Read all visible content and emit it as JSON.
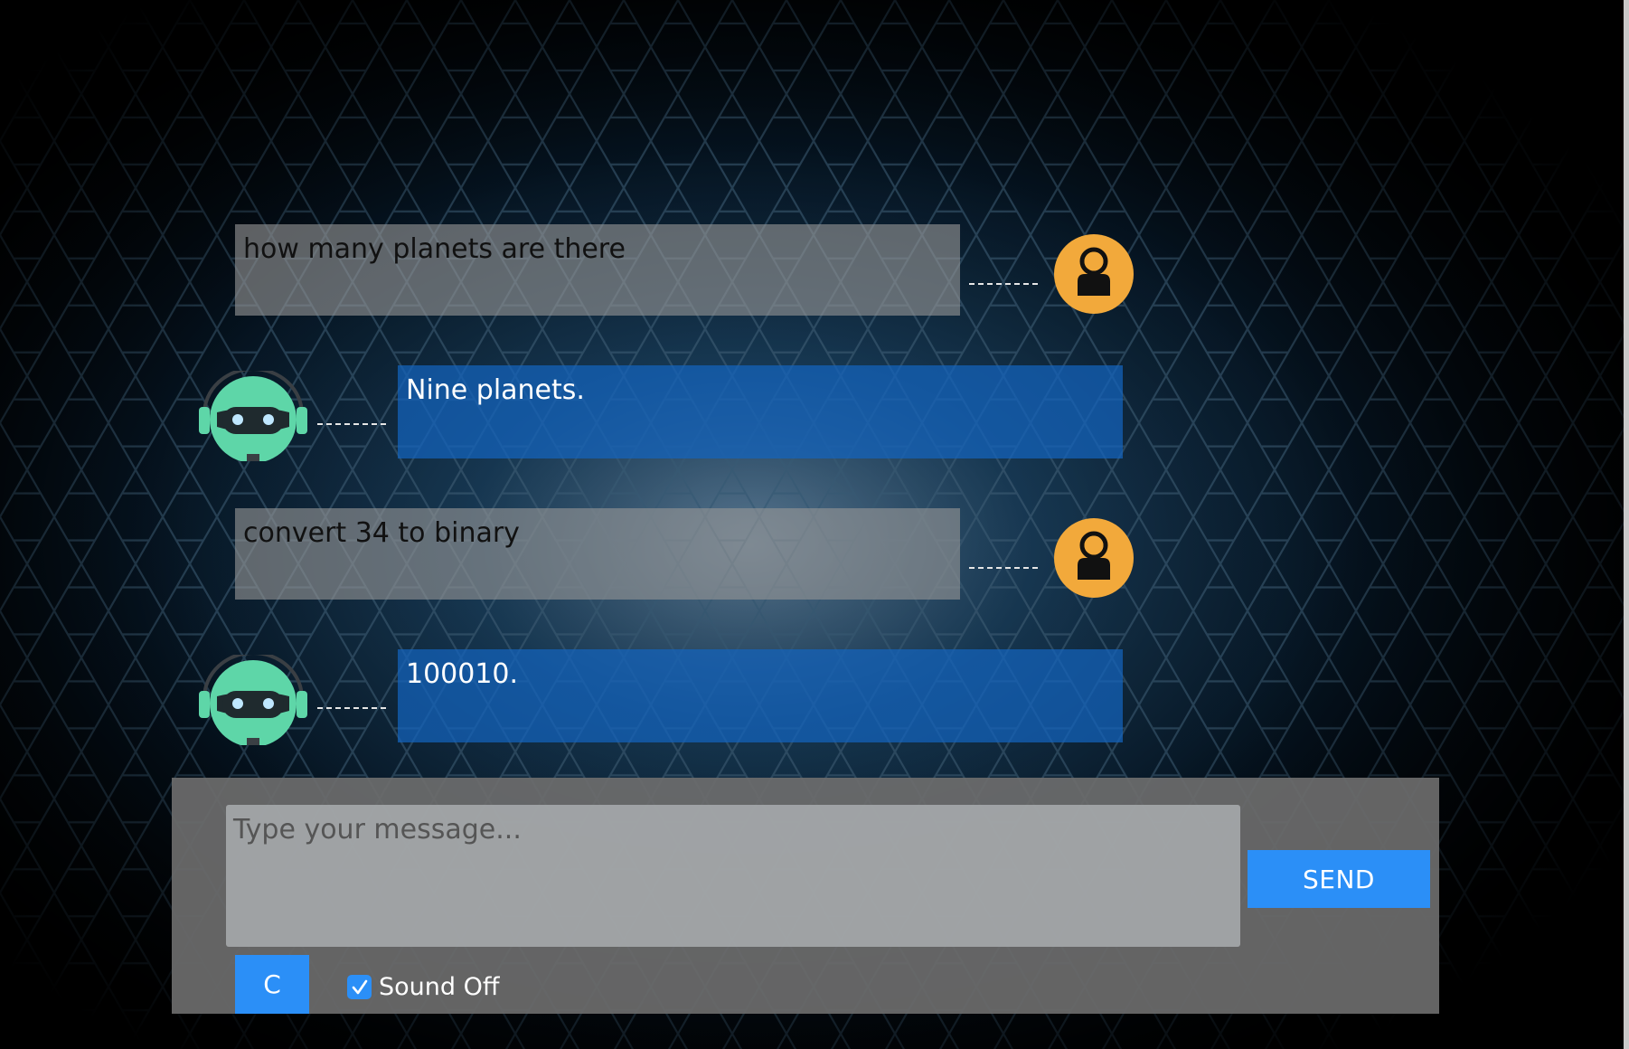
{
  "messages": [
    {
      "sender": "user",
      "text": "how many planets are there"
    },
    {
      "sender": "bot",
      "text": "Nine planets."
    },
    {
      "sender": "user",
      "text": "convert 34 to binary"
    },
    {
      "sender": "bot",
      "text": "100010."
    }
  ],
  "composer": {
    "placeholder": "Type your message...",
    "send_label": "SEND",
    "clear_label": "C",
    "sound_label": "Sound Off",
    "sound_checked": true
  },
  "icons": {
    "user_avatar": "user-avatar-icon",
    "bot_avatar": "robot-avatar-icon",
    "checkbox": "checkmark-icon"
  },
  "colors": {
    "accent": "#2b8ff7",
    "user_avatar": "#f2a93b",
    "bot_avatar": "#5ed6a8",
    "user_bubble": "#969696",
    "bot_bubble": "#1464be",
    "background": "#000000"
  }
}
